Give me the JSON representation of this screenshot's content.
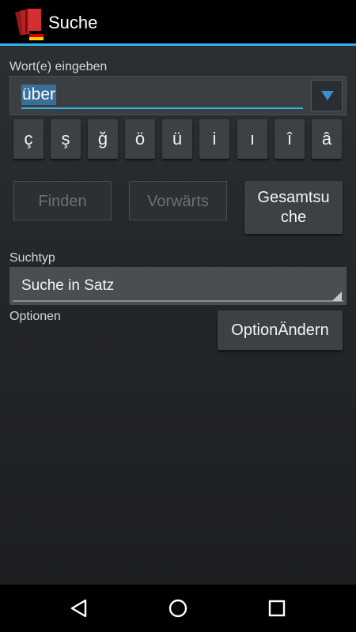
{
  "header": {
    "title": "Suche",
    "icon": "dictionary-book-icon"
  },
  "search": {
    "label": "Wort(e) eingeben",
    "value": "über",
    "dropdown_icon": "triangle-down-icon"
  },
  "special_chars": [
    "ç",
    "ş",
    "ğ",
    "ö",
    "ü",
    "i",
    "ı",
    "î",
    "â"
  ],
  "buttons": {
    "find": "Finden",
    "forward": "Vorwärts",
    "full_search_line1": "Gesamtsu",
    "full_search_line2": "che",
    "change_option": "OptionÄndern"
  },
  "search_type": {
    "label": "Suchtyp",
    "selected": "Suche in Satz"
  },
  "options": {
    "label": "Optionen"
  },
  "colors": {
    "accent": "#33b5e5",
    "dropdown_arrow": "#3b8fd9"
  },
  "navbar": {
    "back": "back-icon",
    "home": "home-icon",
    "recents": "recents-icon"
  }
}
